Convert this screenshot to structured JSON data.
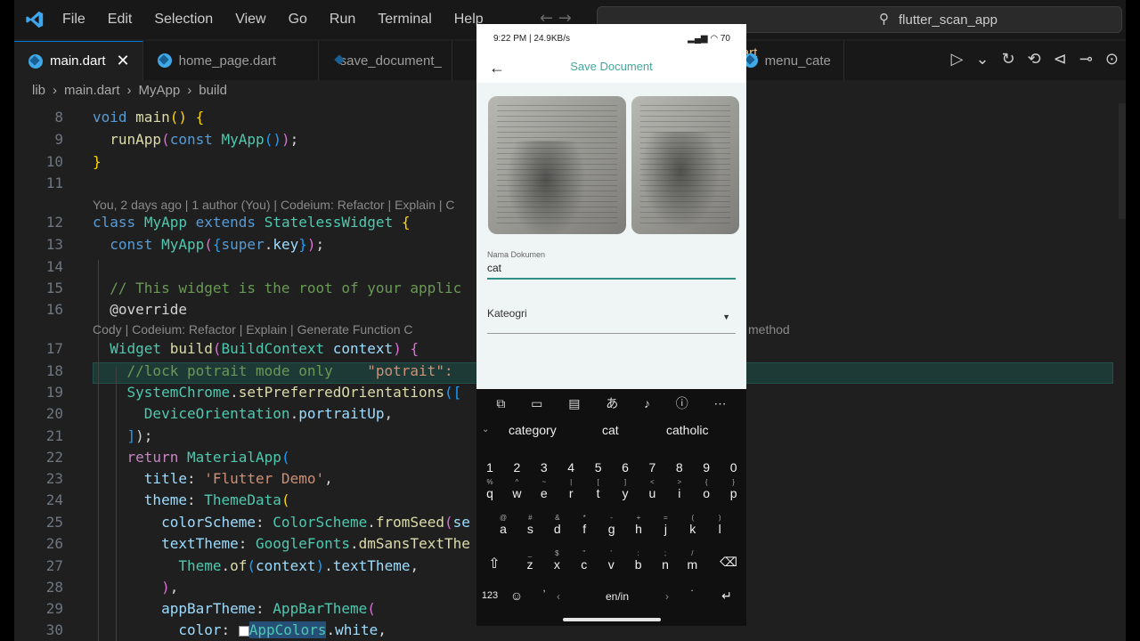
{
  "menubar": {
    "items": [
      "File",
      "Edit",
      "Selection",
      "View",
      "Go",
      "Run",
      "Terminal",
      "Help"
    ],
    "search": "flutter_scan_app"
  },
  "tabs": [
    {
      "label": "main.dart",
      "active": true
    },
    {
      "label": "home_page.dart"
    },
    {
      "label": "save_document_"
    },
    {
      "label": "ge.dart 1"
    },
    {
      "label": "menu_cate"
    }
  ],
  "breadcrumb": [
    "lib",
    "main.dart",
    "MyApp",
    "build"
  ],
  "editor": {
    "line_numbers": [
      "8",
      "9",
      "10",
      "11",
      "12",
      "13",
      "14",
      "15",
      "16",
      "17",
      "18",
      "19",
      "20",
      "21",
      "22",
      "23",
      "24",
      "25",
      "26",
      "27",
      "28",
      "29",
      "30"
    ],
    "lens1": "You, 2 days ago | 1 author (You) | Codeium: Refactor | Explain | C",
    "lens2": "Cody | Codeium: Refactor | Explain | Generate Function C",
    "lens2_tail": "method"
  },
  "phone": {
    "status_time": "9:22 PM | 24.9KB/s",
    "status_right": "70",
    "title": "Save Document",
    "name_label": "Nama Dokumen",
    "name_value": "cat",
    "category_label": "Kateogri",
    "suggestions": [
      "category",
      "cat",
      "catholic"
    ],
    "number_row": [
      "1",
      "2",
      "3",
      "4",
      "5",
      "6",
      "7",
      "8",
      "9",
      "0"
    ],
    "row1": [
      "q",
      "w",
      "e",
      "r",
      "t",
      "y",
      "u",
      "i",
      "o",
      "p"
    ],
    "row1_sup": [
      "%",
      "^",
      "~",
      "|",
      "[",
      "]",
      "<",
      ">",
      "{",
      "}"
    ],
    "row2": [
      "a",
      "s",
      "d",
      "f",
      "g",
      "h",
      "j",
      "k",
      "l"
    ],
    "row2_sup": [
      "@",
      "#",
      "&",
      "*",
      "-",
      "+",
      "=",
      "(",
      ")"
    ],
    "row3": [
      "z",
      "x",
      "c",
      "v",
      "b",
      "n",
      "m"
    ],
    "row3_sup": [
      "_",
      "$",
      "\"",
      "'",
      ":",
      ";",
      "/"
    ],
    "bottom": {
      "num": "123",
      "lang": "en/in"
    }
  }
}
